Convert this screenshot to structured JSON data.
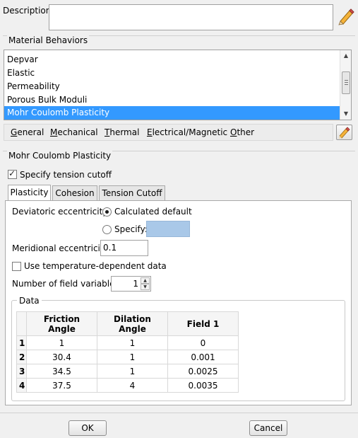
{
  "description": {
    "label": "Description:",
    "value": ""
  },
  "behaviors": {
    "section_title": "Material Behaviors",
    "items": [
      "Depvar",
      "Elastic",
      "Permeability",
      "Porous Bulk Moduli",
      "Mohr Coulomb Plasticity"
    ],
    "selected_index": 4
  },
  "menu": {
    "items": [
      {
        "mnemonic": "G",
        "rest": "eneral"
      },
      {
        "mnemonic": "M",
        "rest": "echanical"
      },
      {
        "mnemonic": "T",
        "rest": "hermal"
      },
      {
        "mnemonic": "E",
        "rest": "lectrical/Magnetic"
      },
      {
        "mnemonic": "O",
        "rest": "ther"
      }
    ]
  },
  "editor": {
    "section_title": "Mohr Coulomb Plasticity",
    "tension_cutoff_label": "Specify tension cutoff",
    "tension_cutoff_checked": true,
    "tabs": [
      "Plasticity",
      "Cohesion",
      "Tension Cutoff"
    ],
    "active_tab": 0,
    "deviatoric_label": "Deviatoric eccentricity:",
    "radio_calculated_label": "Calculated default",
    "radio_specify_label": "Specify:",
    "specify_value": "",
    "meridional_label": "Meridional eccentricity",
    "meridional_value": "0.1",
    "temp_dependent_label": "Use temperature-dependent data",
    "temp_dependent_checked": false,
    "field_vars_label": "Number of field variables:",
    "field_vars_value": "1"
  },
  "data_table": {
    "group_title": "Data",
    "headers": [
      "Friction\nAngle",
      "Dilation\nAngle",
      "Field 1"
    ],
    "rows": [
      [
        "1",
        "1",
        "1",
        "0"
      ],
      [
        "2",
        "30.4",
        "1",
        "0.001"
      ],
      [
        "3",
        "34.5",
        "1",
        "0.0025"
      ],
      [
        "4",
        "37.5",
        "4",
        "0.0035"
      ]
    ]
  },
  "buttons": {
    "ok": "OK",
    "cancel": "Cancel"
  },
  "colors": {
    "selection": "#3399ff",
    "disabled_field": "#a9c8e8"
  },
  "icons": {
    "edit": "pencil-icon"
  }
}
